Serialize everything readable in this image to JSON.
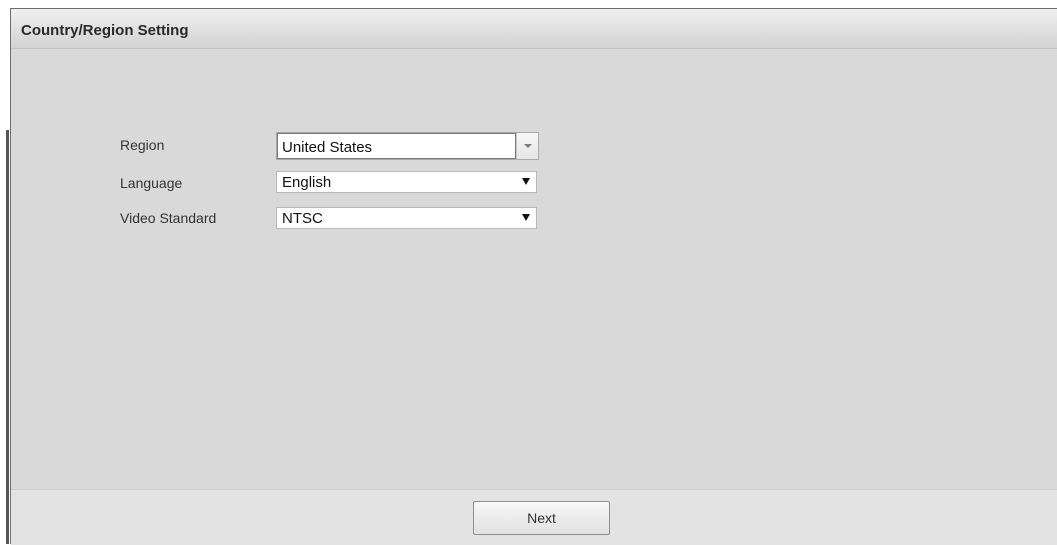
{
  "dialog": {
    "title": "Country/Region Setting"
  },
  "form": {
    "region": {
      "label": "Region",
      "value": "United States"
    },
    "language": {
      "label": "Language",
      "value": "English"
    },
    "video_standard": {
      "label": "Video Standard",
      "value": "NTSC"
    }
  },
  "footer": {
    "next_label": "Next"
  },
  "icons": {
    "region_dropdown": "chevron-down-icon",
    "language_dropdown": "triangle-down-icon",
    "video_standard_dropdown": "triangle-down-icon"
  },
  "colors": {
    "dialog_background": "#d9d9d9",
    "header_background": "#e4e4e4",
    "footer_background": "#e3e3e3",
    "text": "#333333"
  }
}
